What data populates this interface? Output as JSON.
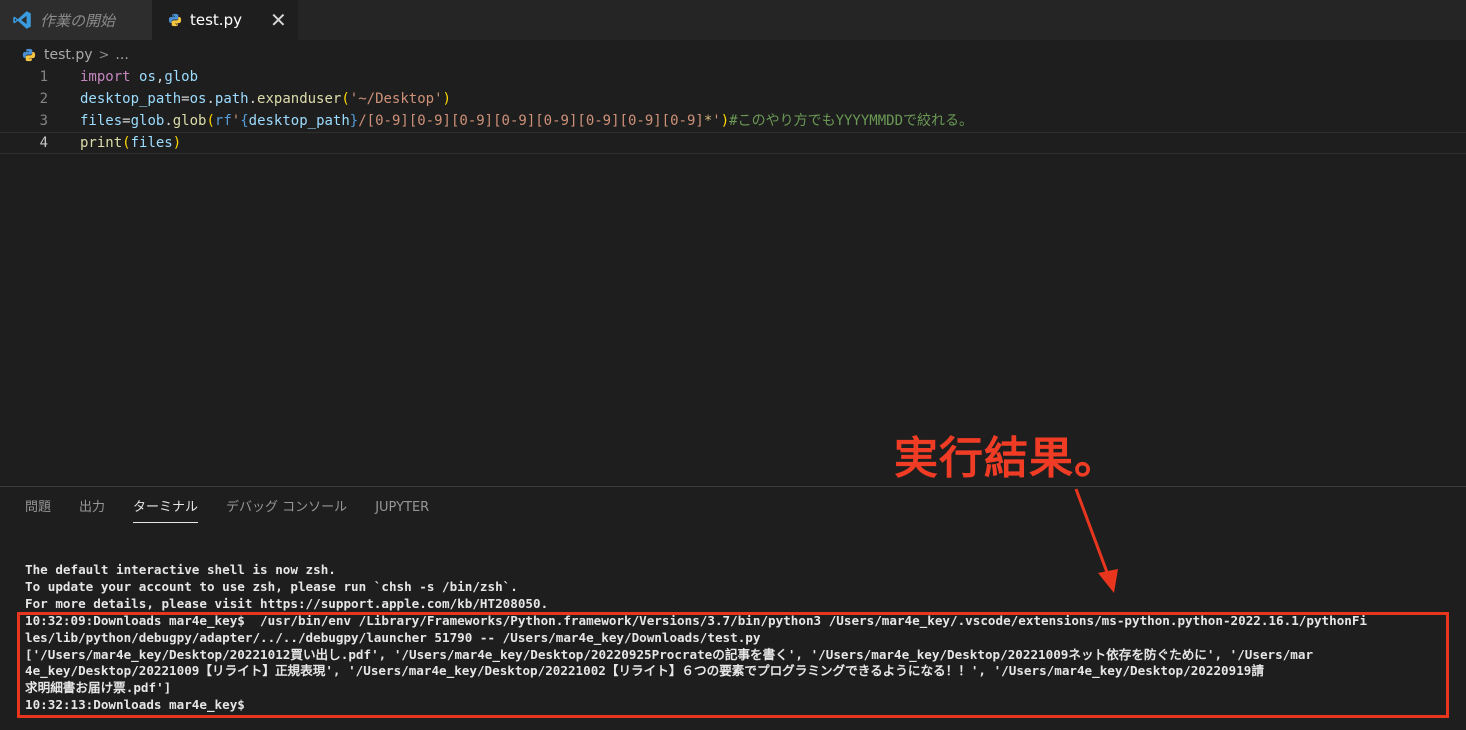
{
  "tabs": [
    {
      "label": "作業の開始",
      "icon": "vscode-icon"
    },
    {
      "label": "test.py",
      "icon": "python-icon",
      "close": "✕"
    }
  ],
  "breadcrumb": {
    "file": "test.py",
    "rest": "..."
  },
  "editor": {
    "line_numbers": [
      "1",
      "2",
      "3",
      "4"
    ],
    "lines": [
      [
        {
          "t": "import",
          "c": "kw"
        },
        {
          "t": " ",
          "c": "pl"
        },
        {
          "t": "os",
          "c": "id"
        },
        {
          "t": ",",
          "c": "pl"
        },
        {
          "t": "glob",
          "c": "id"
        }
      ],
      [
        {
          "t": "desktop_path",
          "c": "id"
        },
        {
          "t": "=",
          "c": "op"
        },
        {
          "t": "os",
          "c": "id"
        },
        {
          "t": ".",
          "c": "pl"
        },
        {
          "t": "path",
          "c": "id"
        },
        {
          "t": ".",
          "c": "pl"
        },
        {
          "t": "expanduser",
          "c": "fn"
        },
        {
          "t": "(",
          "c": "bp"
        },
        {
          "t": "'~/Desktop'",
          "c": "st"
        },
        {
          "t": ")",
          "c": "bp"
        }
      ],
      [
        {
          "t": "files",
          "c": "id"
        },
        {
          "t": "=",
          "c": "op"
        },
        {
          "t": "glob",
          "c": "id"
        },
        {
          "t": ".",
          "c": "pl"
        },
        {
          "t": "glob",
          "c": "fn"
        },
        {
          "t": "(",
          "c": "bp"
        },
        {
          "t": "rf",
          "c": "ps"
        },
        {
          "t": "'",
          "c": "st"
        },
        {
          "t": "{",
          "c": "ps"
        },
        {
          "t": "desktop_path",
          "c": "id"
        },
        {
          "t": "}",
          "c": "ps"
        },
        {
          "t": "/",
          "c": "st"
        },
        {
          "t": "[0-9][0-9][0-9][0-9][0-9][0-9][0-9][0-9]",
          "c": "st"
        },
        {
          "t": "*",
          "c": "esc"
        },
        {
          "t": "'",
          "c": "st"
        },
        {
          "t": ")",
          "c": "bp"
        },
        {
          "t": "#このやり方でもYYYYMMDDで絞れる。",
          "c": "cm"
        }
      ],
      [
        {
          "t": "print",
          "c": "fn"
        },
        {
          "t": "(",
          "c": "bp"
        },
        {
          "t": "files",
          "c": "id"
        },
        {
          "t": ")",
          "c": "bp"
        }
      ]
    ]
  },
  "panel": {
    "tabs": [
      "問題",
      "出力",
      "ターミナル",
      "デバッグ コンソール",
      "JUPYTER"
    ],
    "active_tab": "ターミナル"
  },
  "terminal": {
    "lines": [
      "The default interactive shell is now zsh.",
      "To update your account to use zsh, please run `chsh -s /bin/zsh`.",
      "For more details, please visit https://support.apple.com/kb/HT208050.",
      "10:32:09:Downloads mar4e_key$  /usr/bin/env /Library/Frameworks/Python.framework/Versions/3.7/bin/python3 /Users/mar4e_key/.vscode/extensions/ms-python.python-2022.16.1/pythonFi",
      "les/lib/python/debugpy/adapter/../../debugpy/launcher 51790 -- /Users/mar4e_key/Downloads/test.py",
      "['/Users/mar4e_key/Desktop/20221012買い出し.pdf', '/Users/mar4e_key/Desktop/20220925Procrateの記事を書く', '/Users/mar4e_key/Desktop/20221009ネット依存を防ぐために', '/Users/mar",
      "4e_key/Desktop/20221009【リライト】正規表現', '/Users/mar4e_key/Desktop/20221002【リライト】６つの要素でプログラミングできるようになる！！', '/Users/mar4e_key/Desktop/20220919請",
      "求明細書お届け票.pdf']",
      "10:32:13:Downloads mar4e_key$"
    ]
  },
  "annotation": {
    "text": "実行結果。",
    "color": "#f03c24"
  }
}
